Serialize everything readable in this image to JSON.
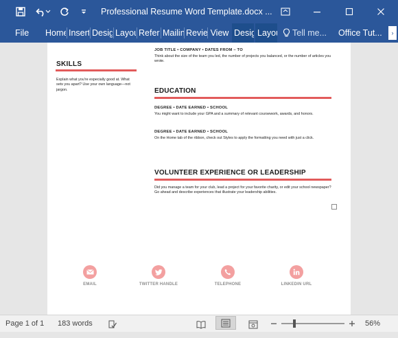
{
  "titlebar": {
    "document_title": "Professional Resume Word Template.docx ...",
    "bg_color": "#2b579a"
  },
  "quick_access": [
    {
      "name": "save-icon"
    },
    {
      "name": "undo-icon"
    },
    {
      "name": "redo-icon"
    },
    {
      "name": "customize-toolbar-icon"
    }
  ],
  "window_controls": {
    "ribbon_display": "ribbon-display-icon",
    "minimize": "minimize-icon",
    "maximize": "maximize-icon",
    "close": "close-icon"
  },
  "ribbon": {
    "tabs": [
      {
        "label": "File"
      },
      {
        "label": "Home"
      },
      {
        "label": "Insert"
      },
      {
        "label": "Design"
      },
      {
        "label": "Layout"
      },
      {
        "label": "References"
      },
      {
        "label": "Mailings"
      },
      {
        "label": "Review"
      },
      {
        "label": "View"
      },
      {
        "label": "Design"
      },
      {
        "label": "Layout"
      }
    ],
    "tell_me": "Tell me...",
    "account": "Office Tut..."
  },
  "document": {
    "skills": {
      "heading": "SKILLS",
      "text": "Explain what you're especially good at. What sets you apart? Use your own language—not jargon."
    },
    "experience_tail": {
      "job_line": "JOB TITLE • COMPANY • DATES FROM – TO",
      "description": "Think about the size of the team you led, the number of projects you balanced, or the number of articles you wrote."
    },
    "education": {
      "heading": "EDUCATION",
      "entries": [
        {
          "subheading": "DEGREE • DATE EARNED • SCHOOL",
          "text": "You might want to include your GPA and a summary of relevant coursework, awards, and honors."
        },
        {
          "subheading": "DEGREE • DATE EARNED • SCHOOL",
          "text": "On the Home tab of the ribbon, check out Styles to apply the formatting you need with just a click."
        }
      ]
    },
    "volunteer": {
      "heading": "VOLUNTEER EXPERIENCE OR LEADERSHIP",
      "text": "Did you manage a team for your club, lead a project for your favorite charity, or edit your school newspaper? Go ahead and describe experiences that illustrate your leadership abilities."
    },
    "contacts": [
      {
        "label": "EMAIL",
        "icon": "email-icon"
      },
      {
        "label": "TWITTER HANDLE",
        "icon": "twitter-icon"
      },
      {
        "label": "TELEPHONE",
        "icon": "telephone-icon"
      },
      {
        "label": "LINKEDIN URL",
        "icon": "linkedin-icon"
      }
    ],
    "accent_color": "#e25b5b"
  },
  "statusbar": {
    "page": "Page 1 of 1",
    "words": "183 words",
    "zoom": "56%",
    "zoom_level": 56
  }
}
